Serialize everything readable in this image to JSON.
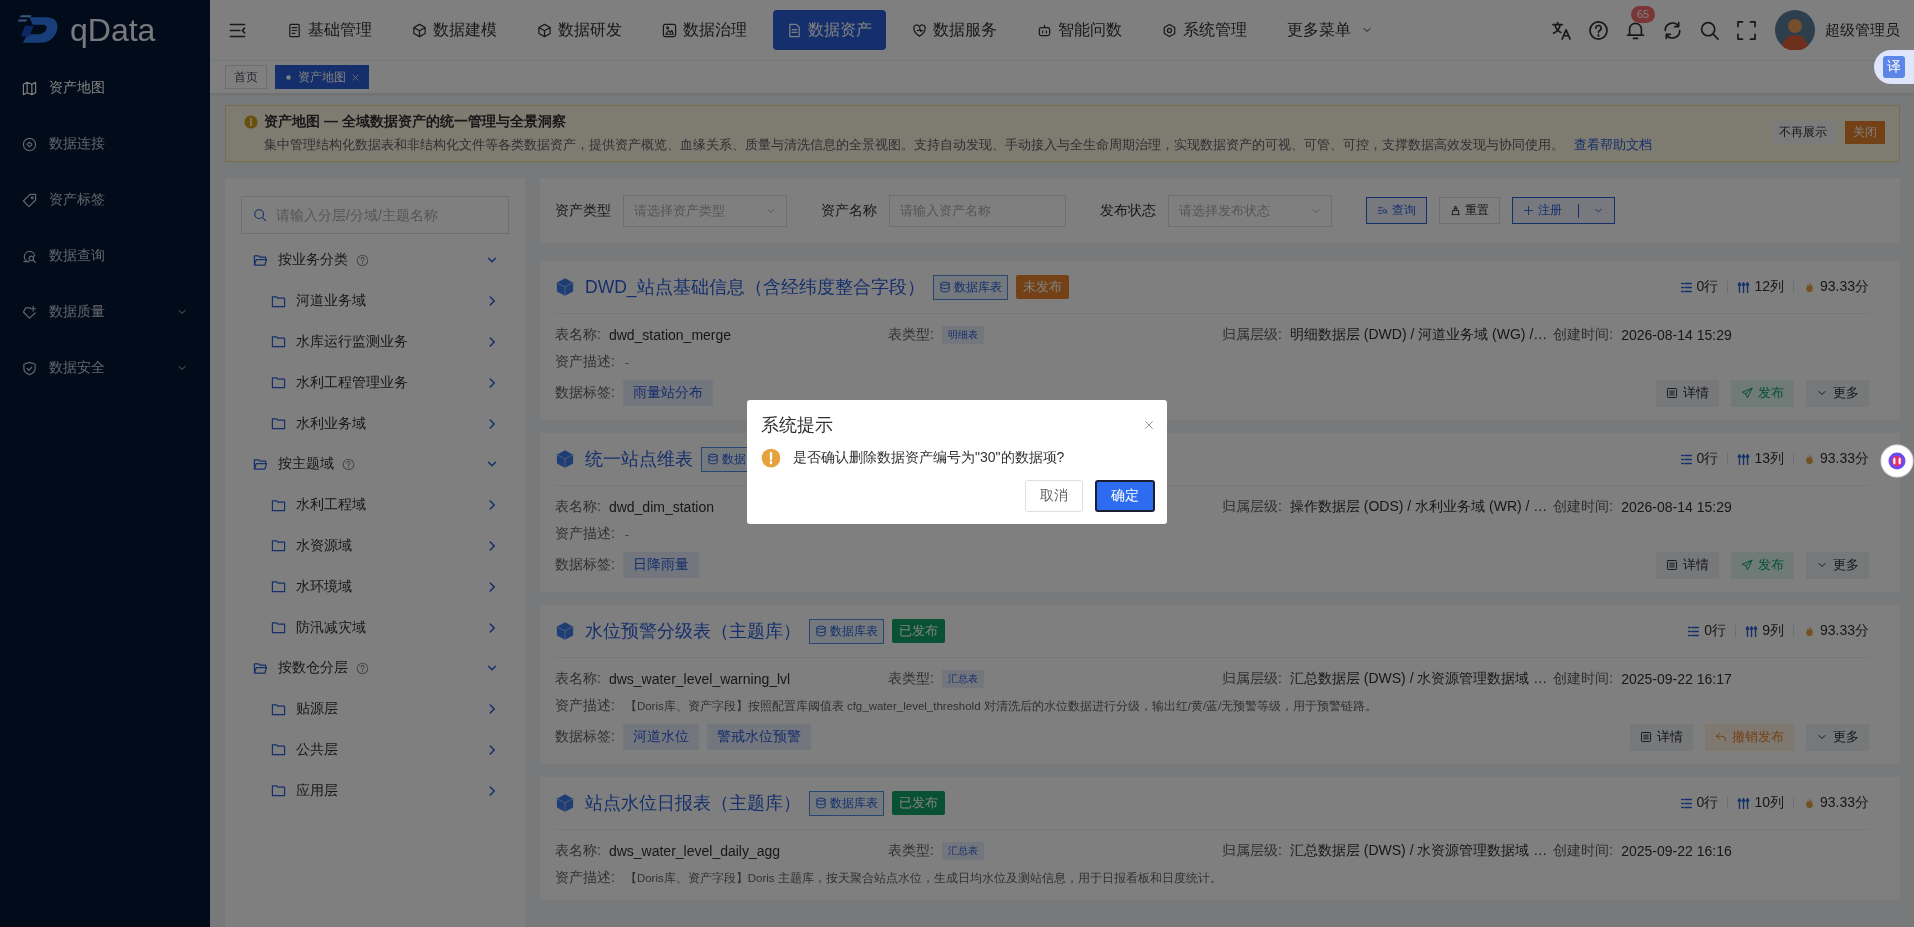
{
  "sidebar": {
    "logo": "qData",
    "items": [
      {
        "label": "资产地图",
        "kind": "link",
        "selected": true
      },
      {
        "label": "数据连接",
        "kind": "link",
        "selected": false
      },
      {
        "label": "资产标签",
        "kind": "link",
        "selected": false
      },
      {
        "label": "数据查询",
        "kind": "link",
        "selected": false
      },
      {
        "label": "数据质量",
        "kind": "group",
        "selected": false
      },
      {
        "label": "数据安全",
        "kind": "group",
        "selected": false
      }
    ]
  },
  "header": {
    "menu": [
      {
        "label": "基础管理",
        "kind": "link",
        "selected": false
      },
      {
        "label": "数据建模",
        "kind": "link",
        "selected": false
      },
      {
        "label": "数据研发",
        "kind": "link",
        "selected": false
      },
      {
        "label": "数据治理",
        "kind": "link",
        "selected": false
      },
      {
        "label": "数据资产",
        "kind": "link",
        "selected": true
      },
      {
        "label": "数据服务",
        "kind": "link",
        "selected": false
      },
      {
        "label": "智能问数",
        "kind": "link",
        "selected": false
      },
      {
        "label": "系统管理",
        "kind": "link",
        "selected": false
      },
      {
        "label": "更多菜单",
        "kind": "dropdown",
        "selected": false
      }
    ],
    "notification_count": "65",
    "user": "超级管理员"
  },
  "tabs": [
    {
      "label": "首页",
      "selected": false,
      "closable": false
    },
    {
      "label": "资产地图",
      "selected": true,
      "closable": true
    }
  ],
  "banner": {
    "title": "资产地图 — 全域数据资产的统一管理与全景洞察",
    "text": "集中管理结构化数据表和非结构化文件等各类数据资产，提供资产概览、血缘关系、质量与清洗信息的全景视图。支持自动发现、手动接入与全生命周期治理，实现数据资产的可视、可管、可控，支撑数据高效发现与协同使用。",
    "link": "查看帮助文档",
    "buttons": [
      {
        "label": "不再展示",
        "kind": "plain"
      },
      {
        "label": "关闭",
        "kind": "warning"
      }
    ]
  },
  "tree": {
    "placeholder": "请输入分层/分域/主题名称",
    "groups": [
      {
        "label": "按业务分类",
        "expanded": true,
        "children": [
          {
            "label": "河道业务域"
          },
          {
            "label": "水库运行监测业务"
          },
          {
            "label": "水利工程管理业务"
          },
          {
            "label": "水利业务域"
          }
        ]
      },
      {
        "label": "按主题域",
        "expanded": true,
        "children": [
          {
            "label": "水利工程域"
          },
          {
            "label": "水资源域"
          },
          {
            "label": "水环境域"
          },
          {
            "label": "防汛减灾域"
          }
        ]
      },
      {
        "label": "按数仓分层",
        "expanded": true,
        "children": [
          {
            "label": "贴源层"
          },
          {
            "label": "公共层"
          },
          {
            "label": "应用层"
          }
        ]
      }
    ]
  },
  "filters": {
    "fields": [
      {
        "label": "资产类型",
        "placeholder": "请选择资产类型",
        "kind": "select"
      },
      {
        "label": "资产名称",
        "placeholder": "请输入资产名称",
        "kind": "input"
      },
      {
        "label": "发布状态",
        "placeholder": "请选择发布状态",
        "kind": "select"
      }
    ],
    "buttons": [
      {
        "label": "查询",
        "kind": "search"
      },
      {
        "label": "重置",
        "kind": "reset"
      },
      {
        "label": "注册",
        "kind": "register"
      }
    ]
  },
  "assets": [
    {
      "title": "DWD_站点基础信息（含经纬度整合字段）",
      "type_tag": "数据库表",
      "status": {
        "label": "未发布",
        "kind": "unpublished"
      },
      "rows": "0行",
      "columns": "12列",
      "score": "93.33分",
      "fields": [
        {
          "kind": "name",
          "label": "表名称:",
          "value": "dwd_station_merge"
        },
        {
          "kind": "type",
          "label": "表类型:",
          "value": "明细表"
        },
        {
          "kind": "layer",
          "label": "归属层级:",
          "value": "明细数据层 (DWD) / 河道业务域 (WG) /…"
        },
        {
          "kind": "created",
          "label": "创建时间:",
          "value": "2026-08-14 15:29"
        }
      ],
      "description": {
        "label": "资产描述:",
        "value": "-"
      },
      "tags_label": "数据标签:",
      "tags": [
        "雨量站分布"
      ],
      "actions": [
        {
          "label": "详情",
          "kind": "detail"
        },
        {
          "label": "发布",
          "kind": "publish"
        },
        {
          "label": "更多",
          "kind": "more"
        }
      ]
    },
    {
      "title": "统一站点维表",
      "type_tag": "数据",
      "rows": "0行",
      "columns": "13列",
      "score": "93.33分",
      "fields": [
        {
          "kind": "name",
          "label": "表名称:",
          "value": "dwd_dim_station"
        },
        {
          "kind": "layer",
          "label": "归属层级:",
          "value": "操作数据层 (ODS) / 水利业务域 (WR) / …"
        },
        {
          "kind": "created",
          "label": "创建时间:",
          "value": "2026-08-14 15:29"
        }
      ],
      "description": {
        "label": "资产描述:",
        "value": "-"
      },
      "tags_label": "数据标签:",
      "tags": [
        "日降雨量"
      ],
      "actions": [
        {
          "label": "详情",
          "kind": "detail"
        },
        {
          "label": "发布",
          "kind": "publish"
        },
        {
          "label": "更多",
          "kind": "more"
        }
      ]
    },
    {
      "title": "水位预警分级表（主题库）",
      "type_tag": "数据库表",
      "status": {
        "label": "已发布",
        "kind": "published"
      },
      "rows": "0行",
      "columns": "9列",
      "score": "93.33分",
      "fields": [
        {
          "kind": "name",
          "label": "表名称:",
          "value": "dws_water_level_warning_lvl"
        },
        {
          "kind": "type",
          "label": "表类型:",
          "value": "汇总表"
        },
        {
          "kind": "layer",
          "label": "归属层级:",
          "value": "汇总数据层 (DWS) / 水资源管理数据域 …"
        },
        {
          "kind": "created",
          "label": "创建时间:",
          "value": "2025-09-22 16:17"
        }
      ],
      "description": {
        "label": "资产描述:",
        "value": "【Doris库、资产字段】按照配置库阈值表 cfg_water_level_threshold 对清洗后的水位数据进行分级，输出红/黄/蓝/无预警等级，用于预警链路。"
      },
      "tags_label": "数据标签:",
      "tags": [
        "河道水位",
        "警戒水位预警"
      ],
      "actions": [
        {
          "label": "详情",
          "kind": "detail"
        },
        {
          "label": "撤销发布",
          "kind": "revoke"
        },
        {
          "label": "更多",
          "kind": "more"
        }
      ]
    },
    {
      "title": "站点水位日报表（主题库）",
      "type_tag": "数据库表",
      "status": {
        "label": "已发布",
        "kind": "published"
      },
      "rows": "0行",
      "columns": "10列",
      "score": "93.33分",
      "fields": [
        {
          "kind": "name",
          "label": "表名称:",
          "value": "dws_water_level_daily_agg"
        },
        {
          "kind": "type",
          "label": "表类型:",
          "value": "汇总表"
        },
        {
          "kind": "layer",
          "label": "归属层级:",
          "value": "汇总数据层 (DWS) / 水资源管理数据域 …"
        },
        {
          "kind": "created",
          "label": "创建时间:",
          "value": "2025-09-22 16:16"
        }
      ],
      "description": {
        "label": "资产描述:",
        "value": "【Doris库、资产字段】Doris 主题库，按天聚合站点水位，生成日均水位及测站信息，用于日报看板和日度统计。"
      }
    }
  ],
  "dialog": {
    "title": "系统提示",
    "message": "是否确认删除数据资产编号为\"30\"的数据项?",
    "buttons": [
      {
        "label": "取消",
        "kind": "default"
      },
      {
        "label": "确定",
        "kind": "primary"
      }
    ]
  },
  "floating": {
    "translate": "译"
  }
}
